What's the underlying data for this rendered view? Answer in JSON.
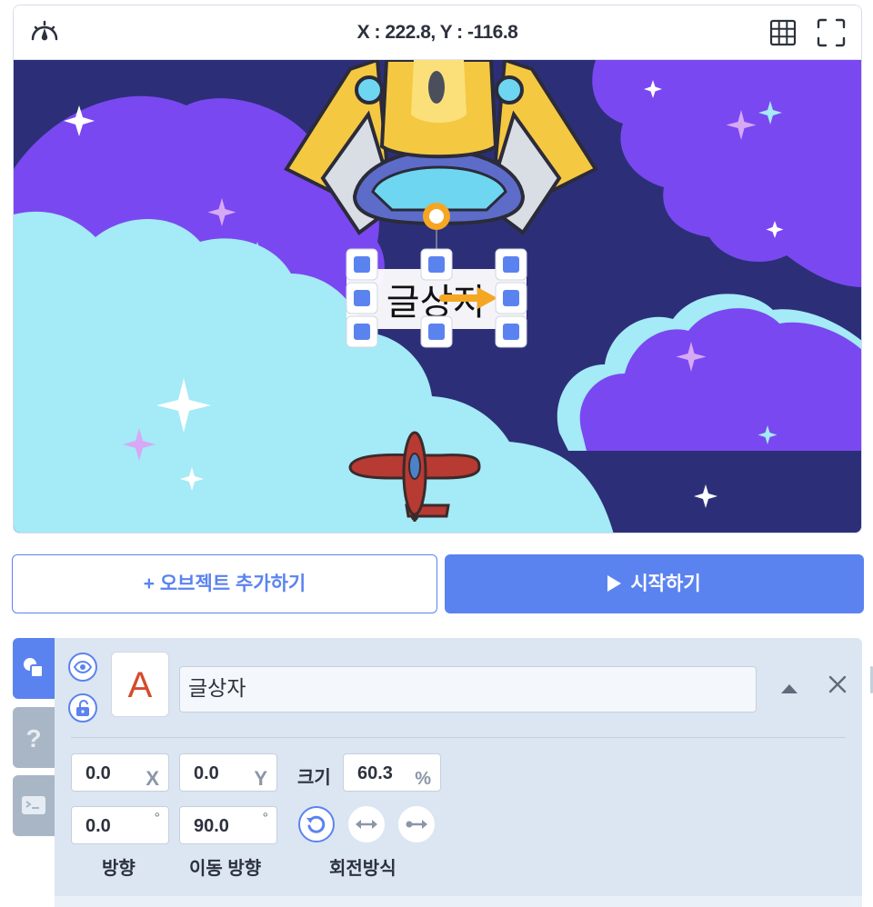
{
  "stage": {
    "coords": "X : 222.8, Y : -116.8",
    "text_object_label": "글상자"
  },
  "actions": {
    "add_object_label": "+ 오브젝트 추가하기",
    "start_label": "시작하기"
  },
  "object_panel": {
    "thumbnail_letter": "A",
    "name": "글상자",
    "x_value": "0.0",
    "x_unit": "X",
    "y_value": "0.0",
    "y_unit": "Y",
    "size_label": "크기",
    "size_value": "60.3",
    "size_unit": "%",
    "direction_value": "0.0",
    "move_direction_value": "90.0",
    "degree_symbol": "°",
    "direction_label": "방향",
    "move_direction_label": "이동 방향",
    "rotation_mode_label": "회전방식"
  },
  "colors": {
    "accent": "#5b83f0",
    "panel_bg": "#dbe6f2",
    "sky": "#2c2f78",
    "cloud_purple": "#7a48f0",
    "cloud_cyan": "#a4eaf7"
  },
  "icons": {
    "speed": "speedometer-icon",
    "grid": "grid-icon",
    "fullscreen": "fullscreen-icon",
    "object_tab": "shapes-icon",
    "help_tab": "question-icon",
    "console_tab": "terminal-icon",
    "visibility": "eye-icon",
    "lock": "unlock-icon",
    "collapse": "caret-up-icon",
    "close": "close-icon",
    "rotate_free": "rotate-icon",
    "rotate_horizontal": "horizontal-flip-icon",
    "rotate_none": "no-rotate-icon"
  }
}
